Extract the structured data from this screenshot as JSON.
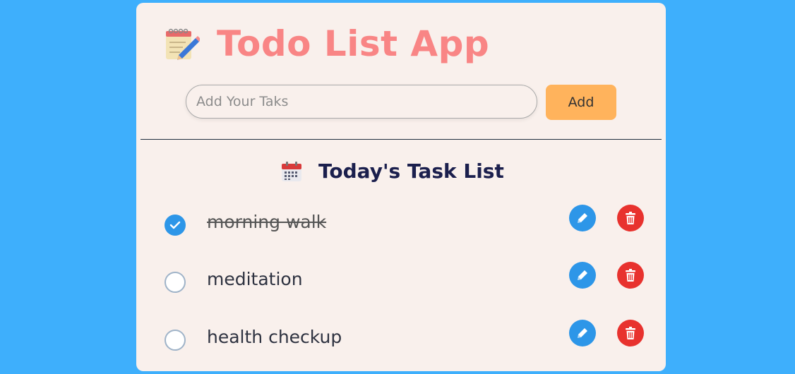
{
  "app": {
    "title": "Todo List App",
    "title_icon": "memo-pencil-icon"
  },
  "input": {
    "placeholder": "Add Your Taks",
    "value": ""
  },
  "add_button": {
    "label": "Add"
  },
  "list": {
    "heading": "Today's Task List",
    "heading_icon": "calendar-icon",
    "tasks": [
      {
        "label": "morning walk",
        "completed": true
      },
      {
        "label": "meditation",
        "completed": false
      },
      {
        "label": "health checkup",
        "completed": false
      }
    ]
  },
  "colors": {
    "background": "#3eaffc",
    "card": "#f9f0ec",
    "title": "#f98585",
    "add_button": "#ffb35c",
    "edit": "#2d96e8",
    "delete": "#e8322e",
    "heading": "#1b1f4d"
  }
}
